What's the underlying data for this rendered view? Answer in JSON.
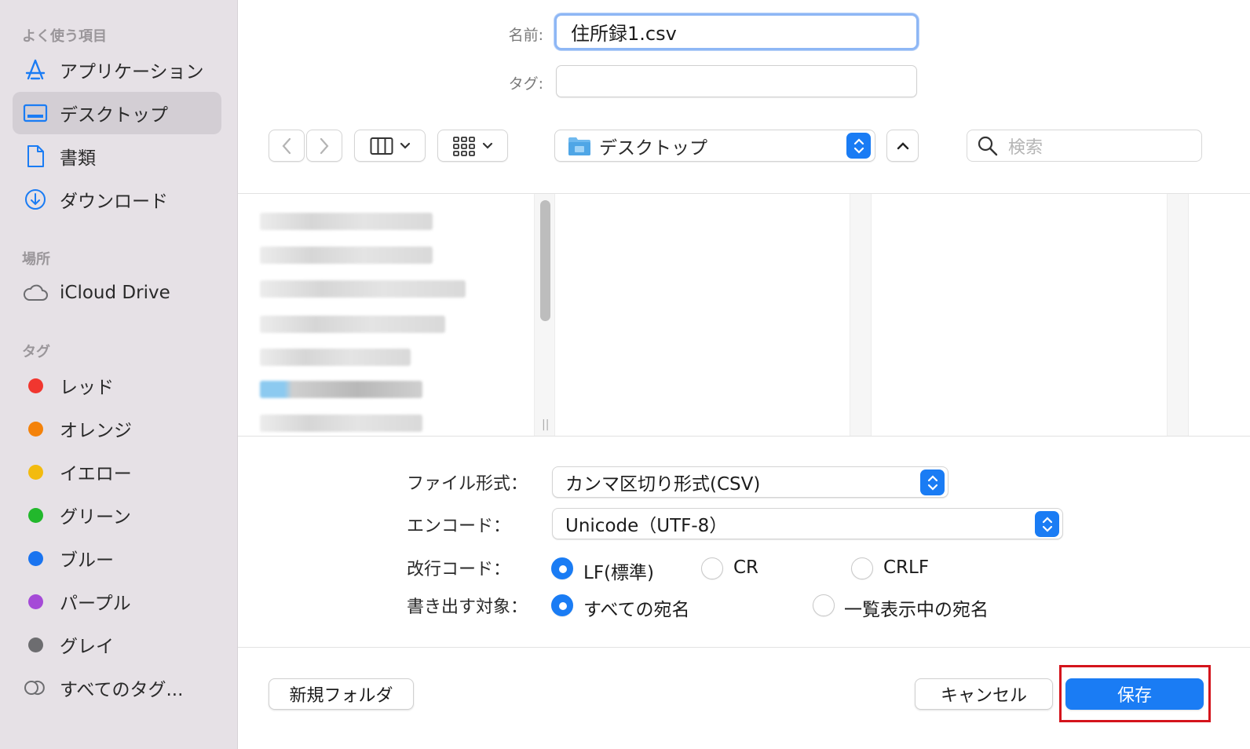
{
  "sidebar": {
    "favorites_heading": "よく使う項目",
    "favorites": [
      {
        "label": "アプリケーション",
        "icon": "app-store-icon"
      },
      {
        "label": "デスクトップ",
        "icon": "desktop-icon"
      },
      {
        "label": "書類",
        "icon": "document-icon"
      },
      {
        "label": "ダウンロード",
        "icon": "download-icon"
      }
    ],
    "locations_heading": "場所",
    "locations": [
      {
        "label": "iCloud Drive",
        "icon": "cloud-icon"
      }
    ],
    "tags_heading": "タグ",
    "tags": [
      {
        "label": "レッド",
        "color": "#f1362f"
      },
      {
        "label": "オレンジ",
        "color": "#f4820a"
      },
      {
        "label": "イエロー",
        "color": "#f3bb0f"
      },
      {
        "label": "グリーン",
        "color": "#22b82c"
      },
      {
        "label": "ブルー",
        "color": "#1a74f0"
      },
      {
        "label": "パープル",
        "color": "#a54ad7"
      },
      {
        "label": "グレイ",
        "color": "#6d6d70"
      }
    ],
    "all_tags": "すべてのタグ..."
  },
  "form": {
    "name_label": "名前:",
    "name_value": "住所録1.csv",
    "tag_label": "タグ:"
  },
  "toolbar": {
    "location": "デスクトップ",
    "search_placeholder": "検索"
  },
  "options": {
    "file_format_label": "ファイル形式：",
    "file_format_value": "カンマ区切り形式(CSV)",
    "encoding_label": "エンコード：",
    "encoding_value": "Unicode（UTF-8）",
    "newline_label": "改行コード：",
    "newline_options": [
      "LF(標準)",
      "CR",
      "CRLF"
    ],
    "export_label": "書き出す対象：",
    "export_options": [
      "すべての宛名",
      "一覧表示中の宛名"
    ]
  },
  "buttons": {
    "new_folder": "新規フォルダ",
    "cancel": "キャンセル",
    "save": "保存"
  },
  "colors": {
    "accent": "#1a7cf4",
    "highlight": "#d4141c"
  }
}
